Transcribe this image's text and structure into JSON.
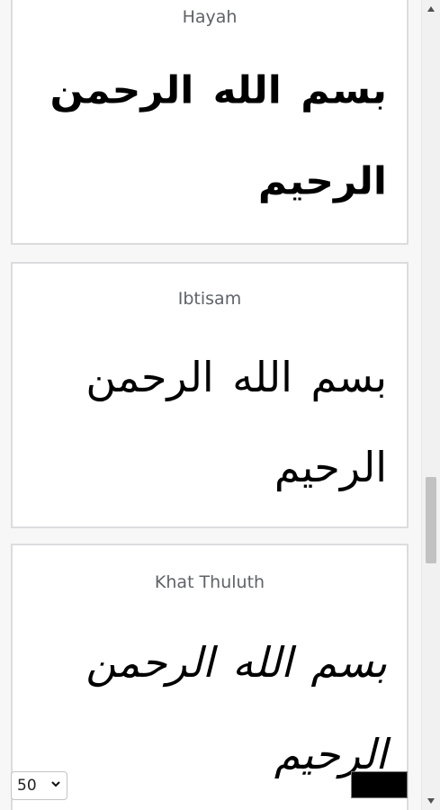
{
  "cards": [
    {
      "font_name": "Hayah",
      "sample_line1": "بسم الله الرحمن",
      "sample_line2": "الرحيم"
    },
    {
      "font_name": "Ibtisam",
      "sample_line1": "بسم الله الرحمن",
      "sample_line2": "الرحيم"
    },
    {
      "font_name": "Khat Thuluth",
      "sample_line1": "بسم الله الرحمن",
      "sample_line2": "الرحيم"
    }
  ],
  "controls": {
    "font_size_value": "50",
    "text_color": "#000000"
  },
  "icons": {
    "scroll_up": "triangle-up-icon",
    "scroll_down": "triangle-down-icon",
    "select_chevron": "chevron-down-icon"
  }
}
